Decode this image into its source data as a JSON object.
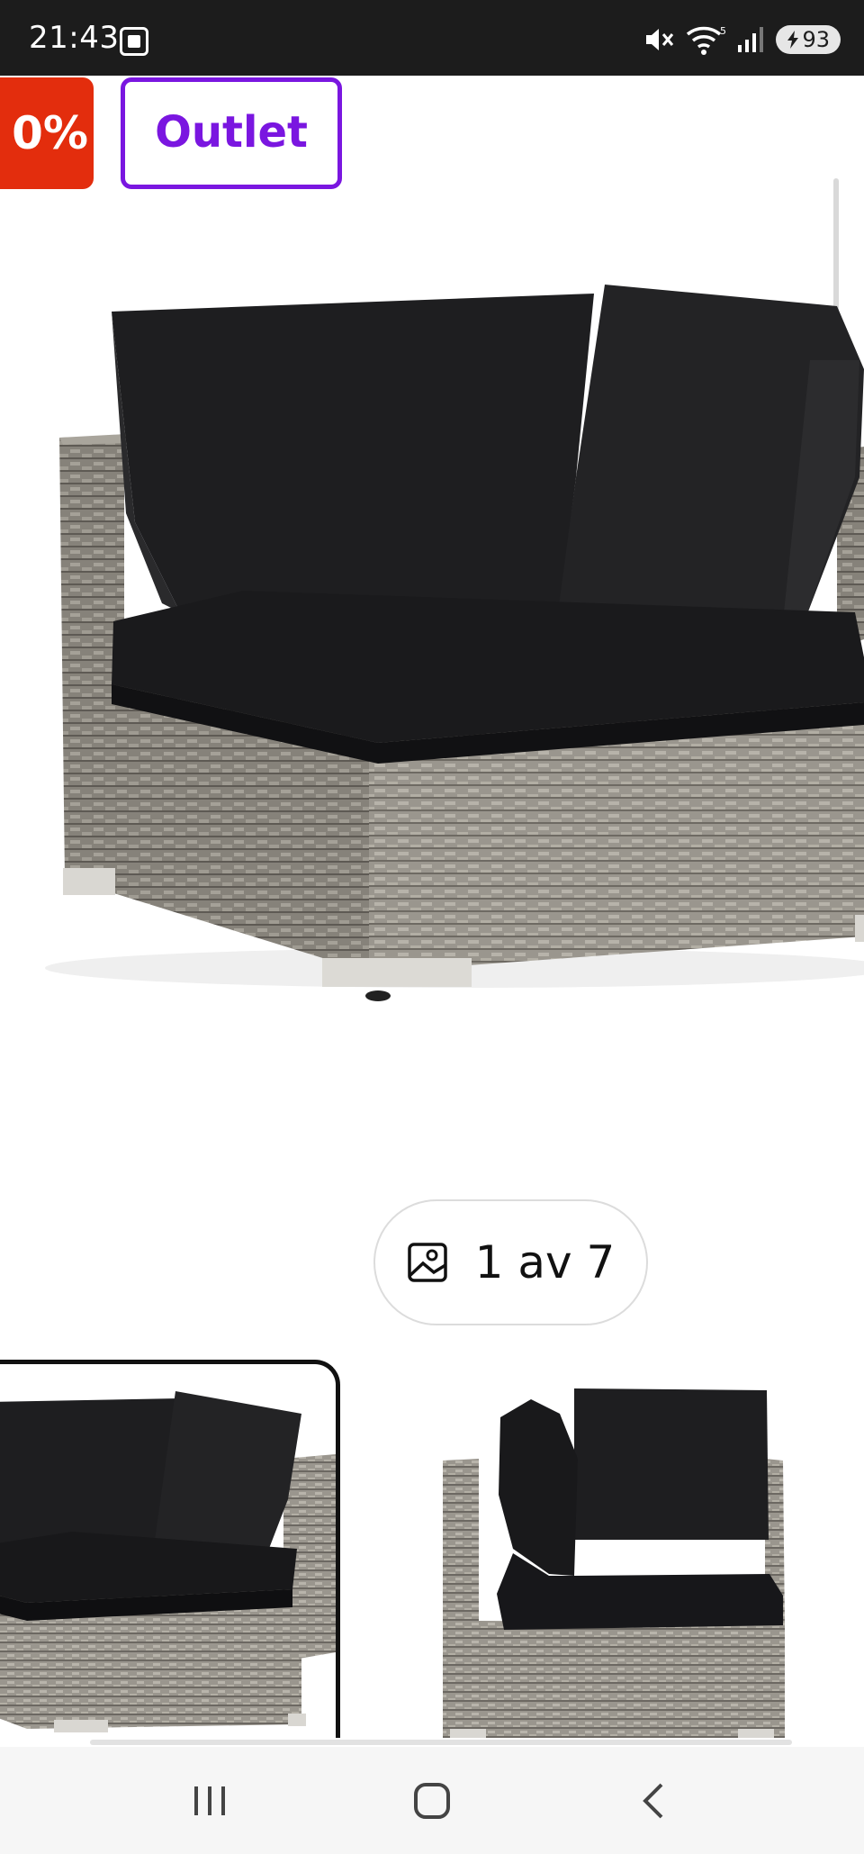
{
  "status_bar": {
    "time": "21:43",
    "wifi_label": "5",
    "battery": "93",
    "icons": [
      "screenshot-icon",
      "mute-icon",
      "wifi-icon",
      "signal-icon",
      "battery-icon"
    ]
  },
  "badges": {
    "sale": "0%",
    "outlet": "Outlet",
    "sale_color": "#e32d0d",
    "outlet_color": "#7a16e0"
  },
  "gallery": {
    "counter": "1 av 7",
    "counter_icon": "image-icon",
    "thumbnails": [
      {
        "name": "thumbnail-1",
        "selected": true
      },
      {
        "name": "thumbnail-2",
        "selected": false
      }
    ]
  },
  "nav_bar": {
    "buttons": [
      "recents-icon",
      "home-icon",
      "back-icon"
    ]
  }
}
